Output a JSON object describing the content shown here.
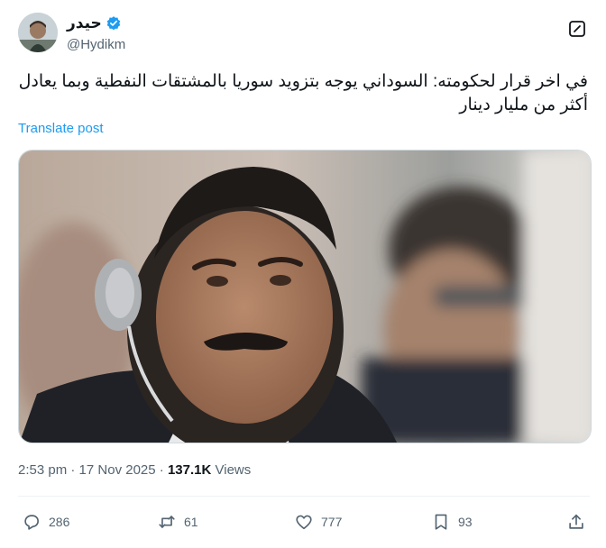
{
  "author": {
    "display_name": "حيدر",
    "handle": "@Hydikm",
    "verified_color": "#1d9bf0"
  },
  "tweet": {
    "text_line1": "في اخر قرار لحكومته: السوداني يوجه بتزويد سوريا بالمشتقات النفطية وبما يعادل",
    "text_line2": "أكثر من مليار دينار",
    "translate_label": "Translate post",
    "image_description_icon": "photo-of-man-with-earpiece"
  },
  "meta": {
    "time": "2:53 pm",
    "separator": "·",
    "date": "17 Nov 2025",
    "views_count": "137.1K",
    "views_label": "Views"
  },
  "actions": {
    "replies": "286",
    "reposts": "61",
    "likes": "777",
    "bookmarks": "93"
  },
  "colors": {
    "accent": "#1d9bf0",
    "secondary_text": "#536471",
    "primary_text": "#0f1419"
  }
}
